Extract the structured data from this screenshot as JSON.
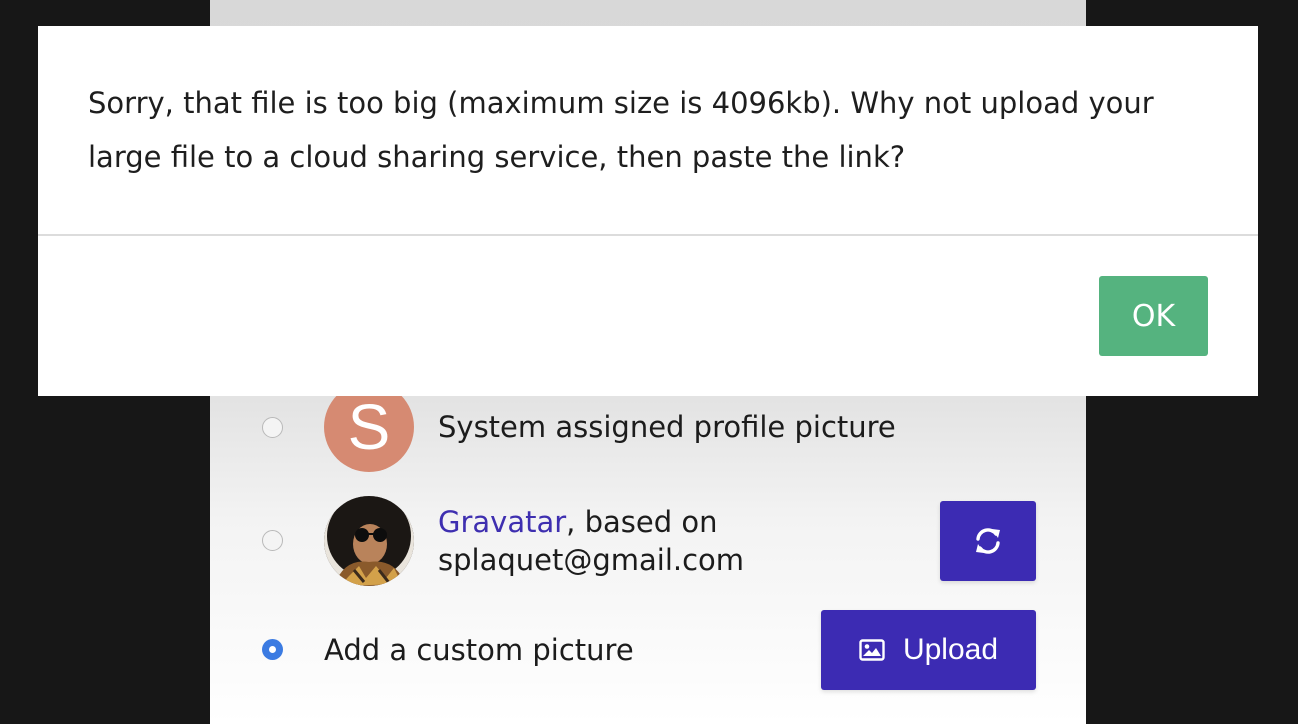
{
  "modal": {
    "message": "Sorry, that file is too big (maximum size is 4096kb). Why not upload your large file to a cloud sharing service, then paste the link?",
    "ok_label": "OK"
  },
  "profile_picture": {
    "options": [
      {
        "avatar_letter": "S",
        "label": "System assigned profile picture",
        "selected": false
      },
      {
        "link_text": "Gravatar",
        "label_line1_suffix": ", based on",
        "label_line2": "splaquet@gmail.com",
        "button_icon": "refresh-icon",
        "selected": false
      },
      {
        "label": "Add a custom picture",
        "button_icon": "image-icon",
        "button_label": "Upload",
        "selected": true
      }
    ]
  },
  "colors": {
    "modal_ok": "#55b37f",
    "primary_button": "#3c2bb3",
    "radio_selected": "#3b7be2",
    "system_avatar": "#d68a72",
    "link": "#3e2fb0",
    "backdrop": "#171717"
  }
}
